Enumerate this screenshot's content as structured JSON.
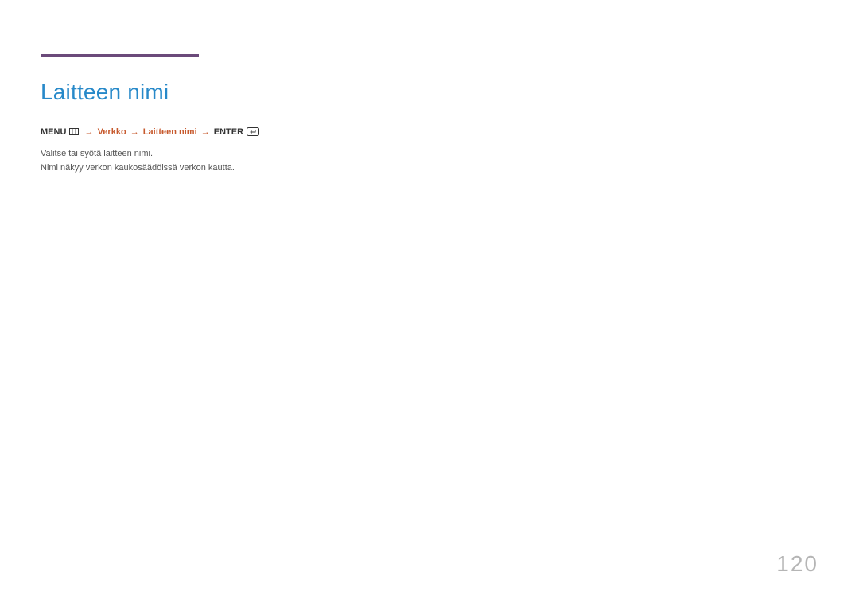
{
  "header": {
    "title": "Laitteen nimi"
  },
  "breadcrumb": {
    "menu_label": "MENU",
    "arrow": "→",
    "path1": "Verkko",
    "path2": "Laitteen nimi",
    "enter_label": "ENTER"
  },
  "body": {
    "line1": "Valitse tai syötä laitteen nimi.",
    "line2": "Nimi näkyy verkon kaukosäädöissä verkon kautta."
  },
  "page_number": "120"
}
